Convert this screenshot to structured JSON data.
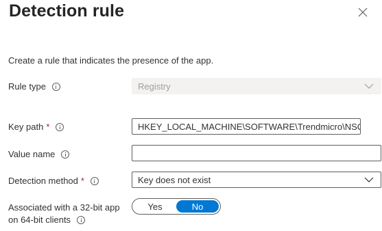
{
  "panel": {
    "title": "Detection rule",
    "description": "Create a rule that indicates the presence of the app."
  },
  "icons": {
    "close": "close-icon",
    "info": "info-icon",
    "chevron": "chevron-down-icon"
  },
  "fields": {
    "rule_type": {
      "label": "Rule type",
      "value": "Registry",
      "disabled": true
    },
    "key_path": {
      "label": "Key path",
      "required_marker": "*",
      "value": "HKEY_LOCAL_MACHINE\\SOFTWARE\\Trendmicro\\NSC"
    },
    "value_name": {
      "label": "Value name",
      "value": ""
    },
    "detection_method": {
      "label": "Detection method",
      "required_marker": "*",
      "value": "Key does not exist"
    },
    "associated_32bit": {
      "label_line1": "Associated with a 32-bit app",
      "label_line2": "on 64-bit clients",
      "options": [
        "Yes",
        "No"
      ],
      "selected": "No"
    }
  },
  "colors": {
    "accent": "#0078d4",
    "required": "#a4262c",
    "disabled_bg": "#f3f2f1"
  }
}
